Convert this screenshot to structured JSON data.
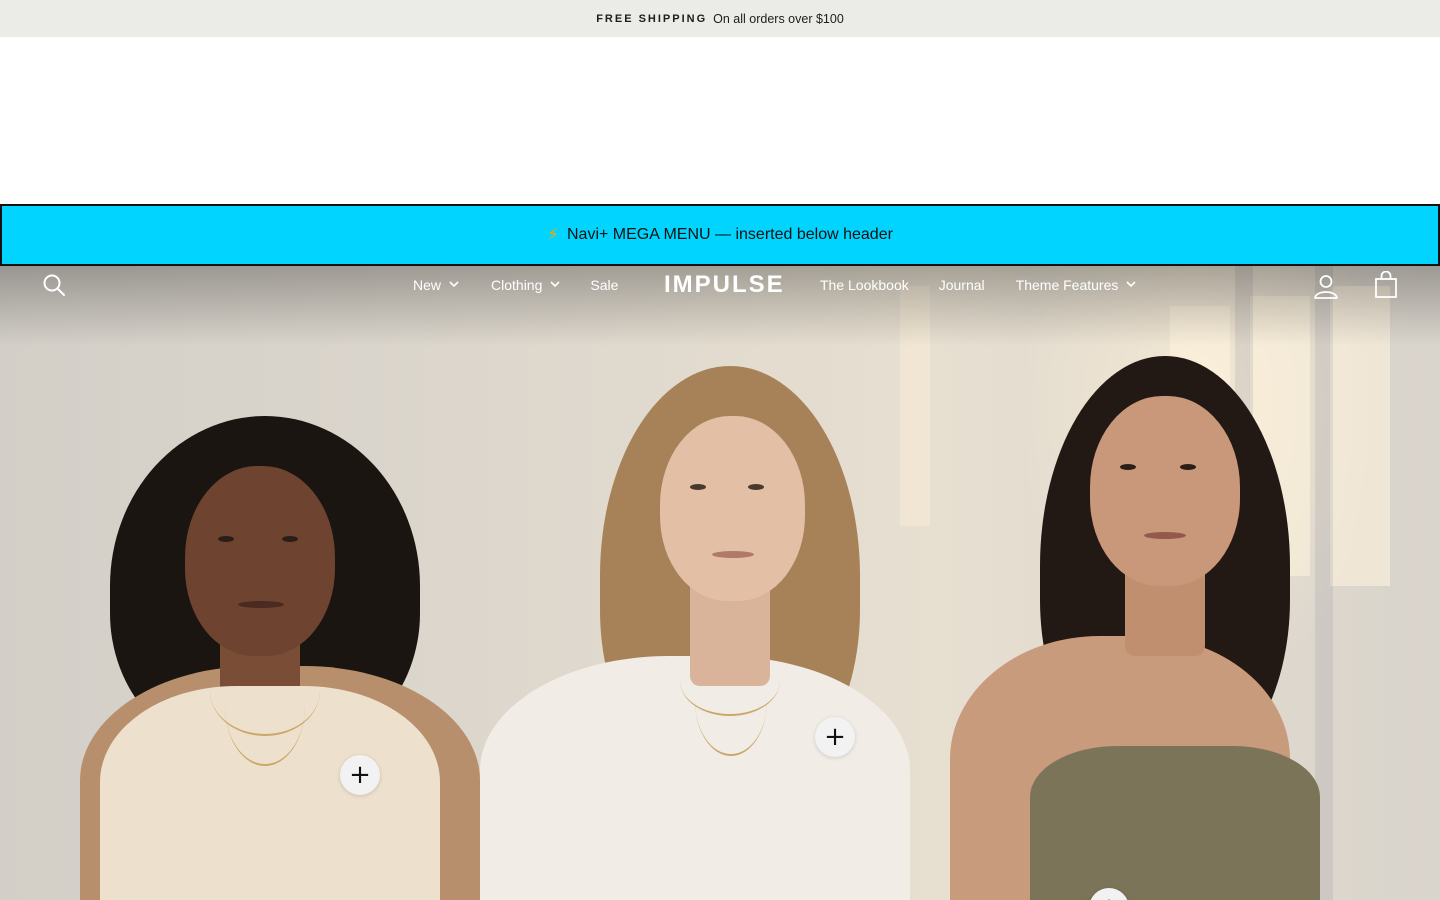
{
  "announcement": {
    "title": "FREE SHIPPING",
    "text": "On all orders over $100"
  },
  "navi_banner": {
    "icon": "lightning-icon",
    "glyph": "⚡",
    "text": "Navi+ MEGA MENU — inserted below header"
  },
  "nav": {
    "logo": "IMPULSE",
    "left_links": [
      {
        "label": "New",
        "dropdown": true
      },
      {
        "label": "Clothing",
        "dropdown": true
      },
      {
        "label": "Sale",
        "dropdown": false
      }
    ],
    "right_links": [
      {
        "label": "The Lookbook",
        "dropdown": false
      },
      {
        "label": "Journal",
        "dropdown": false
      },
      {
        "label": "Theme Features",
        "dropdown": true
      }
    ],
    "icons": {
      "search": "search-icon",
      "account": "account-icon",
      "cart": "cart-icon"
    }
  },
  "hero": {
    "hotspots": [
      {
        "symbol": "+"
      },
      {
        "symbol": "+"
      },
      {
        "symbol": "+"
      }
    ]
  },
  "colors": {
    "announcement_bg": "#ebebe8",
    "navi_banner_bg": "#00d4ff",
    "nav_text": "#ffffff"
  }
}
